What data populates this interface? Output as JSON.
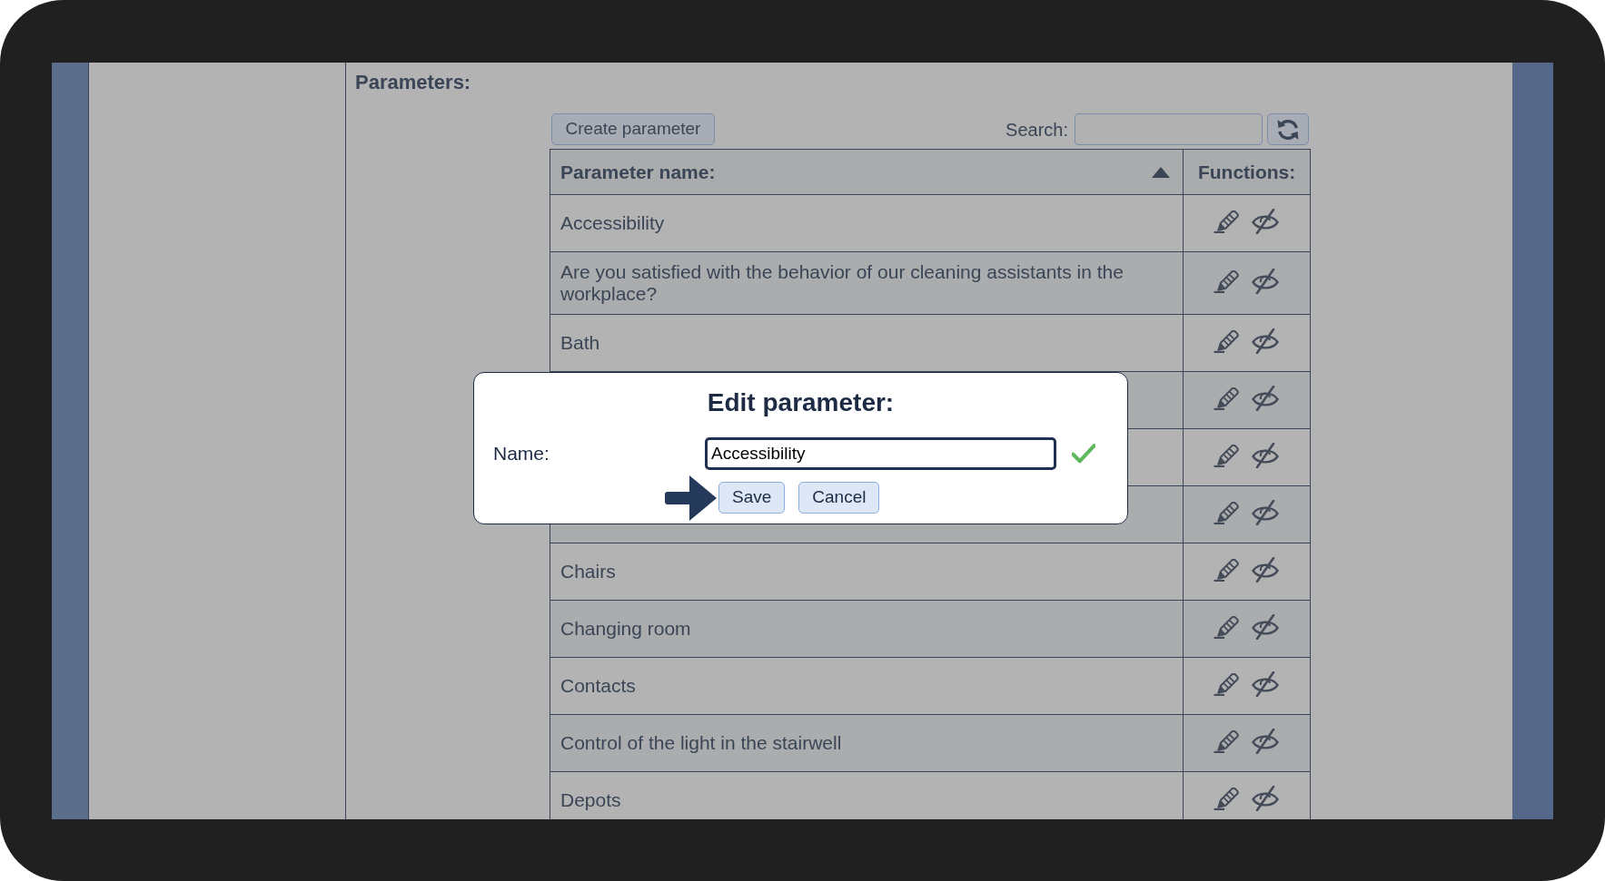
{
  "page": {
    "heading": "Parameters:"
  },
  "toolbar": {
    "create_button": "Create parameter",
    "search_label": "Search:"
  },
  "table": {
    "columns": [
      {
        "label": "Parameter name:",
        "sorted": true
      },
      {
        "label": "Functions:"
      }
    ],
    "rows": [
      {
        "name": "Accessibility"
      },
      {
        "name": "Are you satisfied with the behavior of our cleaning assistants in the workplace?"
      },
      {
        "name": "Bath"
      },
      {},
      {},
      {},
      {
        "name": "Chairs"
      },
      {
        "name": "Changing room"
      },
      {
        "name": "Contacts"
      },
      {
        "name": "Control of the light in the stairwell"
      },
      {
        "name": "Depots"
      }
    ]
  },
  "dialog": {
    "title": "Edit parameter:",
    "field": {
      "label": "Name:",
      "value": "Accessibility",
      "valid": true
    },
    "buttons": [
      {
        "label": "Save",
        "arrow": true
      },
      {
        "label": "Cancel",
        "arrow": false
      }
    ]
  }
}
